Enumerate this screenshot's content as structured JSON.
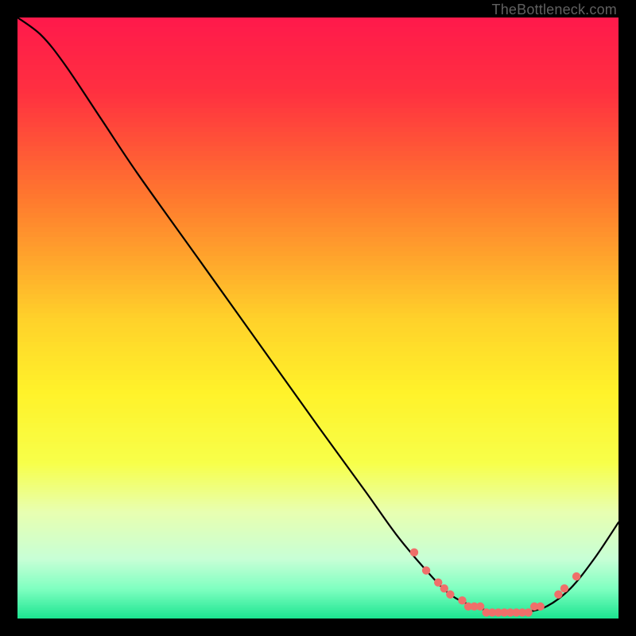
{
  "attribution": "TheBottleneck.com",
  "colors": {
    "frame": "#000000",
    "curve_stroke": "#000000",
    "marker_fill": "#ef6f6a",
    "gradient_stops": [
      {
        "offset": 0.0,
        "color": "#ff1a4b"
      },
      {
        "offset": 0.12,
        "color": "#ff3040"
      },
      {
        "offset": 0.3,
        "color": "#ff7a2e"
      },
      {
        "offset": 0.5,
        "color": "#ffd22a"
      },
      {
        "offset": 0.62,
        "color": "#fff22a"
      },
      {
        "offset": 0.74,
        "color": "#f7ff4a"
      },
      {
        "offset": 0.82,
        "color": "#e8ffb0"
      },
      {
        "offset": 0.9,
        "color": "#c7ffd6"
      },
      {
        "offset": 0.95,
        "color": "#7effc0"
      },
      {
        "offset": 1.0,
        "color": "#19e38f"
      }
    ]
  },
  "chart_data": {
    "type": "line",
    "title": "",
    "xlabel": "",
    "ylabel": "",
    "xlim": [
      0,
      100
    ],
    "ylim": [
      0,
      100
    ],
    "curve": [
      {
        "x": 0,
        "y": 100
      },
      {
        "x": 4,
        "y": 97
      },
      {
        "x": 8,
        "y": 92
      },
      {
        "x": 14,
        "y": 83
      },
      {
        "x": 20,
        "y": 74
      },
      {
        "x": 30,
        "y": 60
      },
      {
        "x": 40,
        "y": 46
      },
      {
        "x": 50,
        "y": 32
      },
      {
        "x": 58,
        "y": 21
      },
      {
        "x": 63,
        "y": 14
      },
      {
        "x": 68,
        "y": 8
      },
      {
        "x": 72,
        "y": 4
      },
      {
        "x": 76,
        "y": 2
      },
      {
        "x": 80,
        "y": 1
      },
      {
        "x": 84,
        "y": 1
      },
      {
        "x": 88,
        "y": 2
      },
      {
        "x": 92,
        "y": 5
      },
      {
        "x": 96,
        "y": 10
      },
      {
        "x": 100,
        "y": 16
      }
    ],
    "marker_points": [
      {
        "x": 66,
        "y": 11
      },
      {
        "x": 68,
        "y": 8
      },
      {
        "x": 70,
        "y": 6
      },
      {
        "x": 71,
        "y": 5
      },
      {
        "x": 72,
        "y": 4
      },
      {
        "x": 74,
        "y": 3
      },
      {
        "x": 75,
        "y": 2
      },
      {
        "x": 76,
        "y": 2
      },
      {
        "x": 77,
        "y": 2
      },
      {
        "x": 78,
        "y": 1
      },
      {
        "x": 79,
        "y": 1
      },
      {
        "x": 80,
        "y": 1
      },
      {
        "x": 81,
        "y": 1
      },
      {
        "x": 82,
        "y": 1
      },
      {
        "x": 83,
        "y": 1
      },
      {
        "x": 84,
        "y": 1
      },
      {
        "x": 85,
        "y": 1
      },
      {
        "x": 86,
        "y": 2
      },
      {
        "x": 87,
        "y": 2
      },
      {
        "x": 90,
        "y": 4
      },
      {
        "x": 91,
        "y": 5
      },
      {
        "x": 93,
        "y": 7
      }
    ]
  }
}
